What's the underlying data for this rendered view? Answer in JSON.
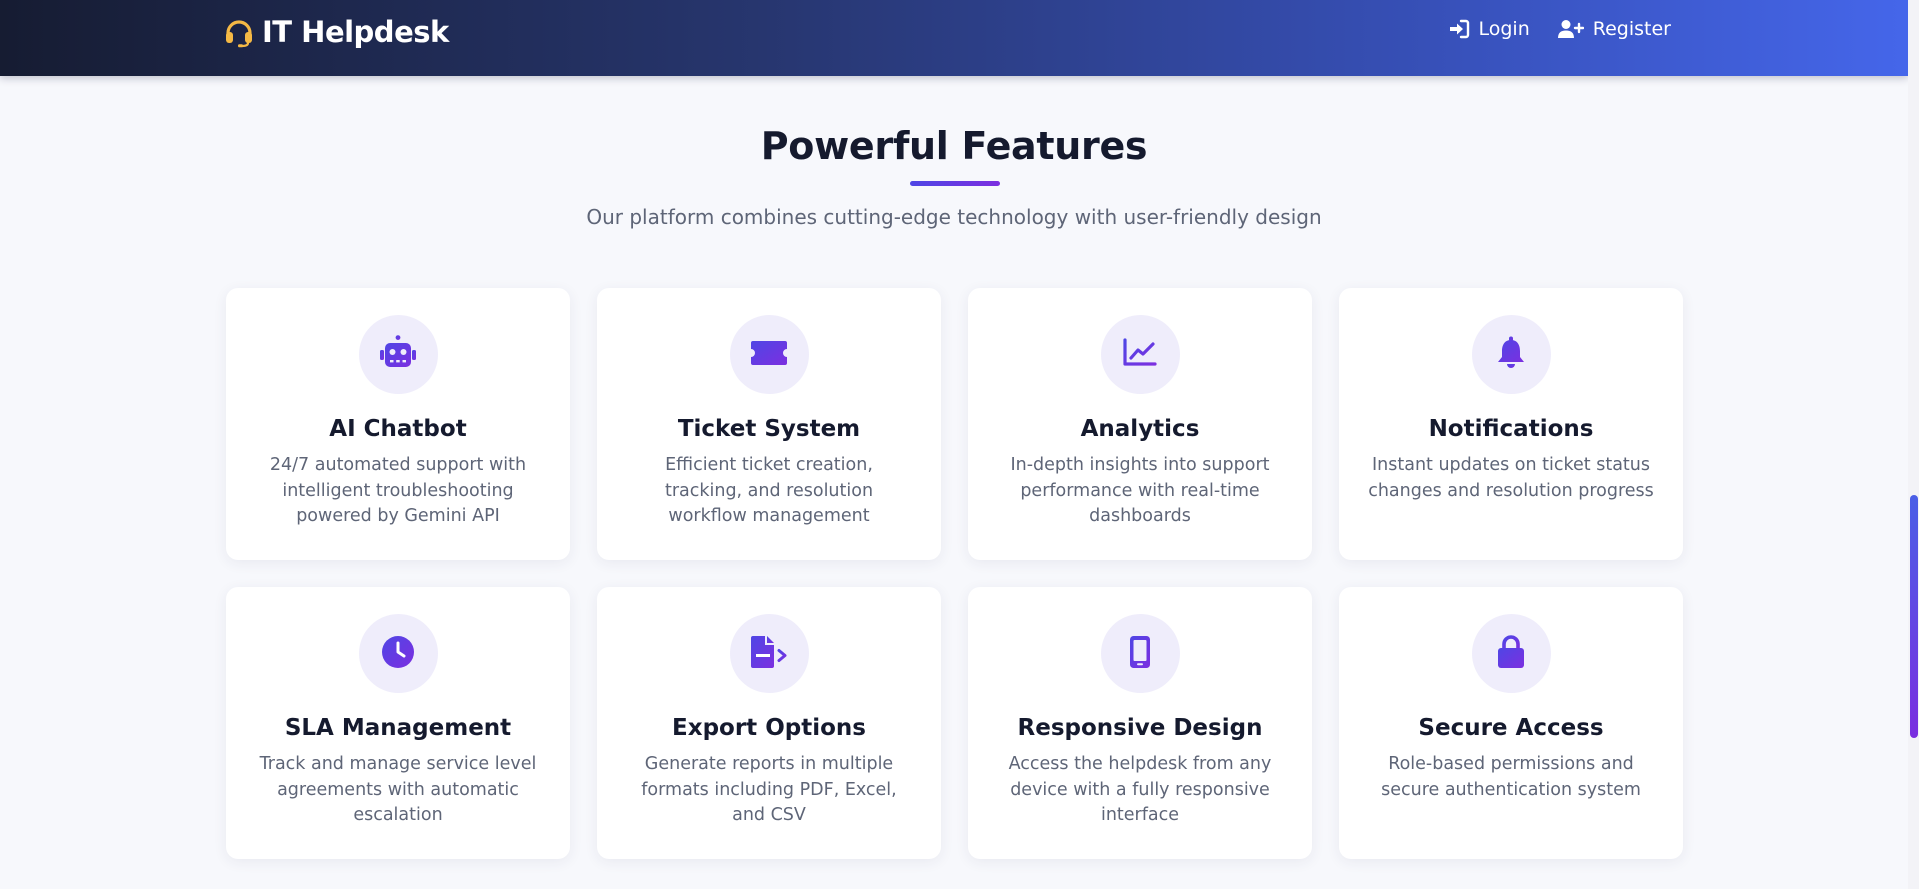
{
  "navbar": {
    "brand": "IT Helpdesk",
    "brand_icon": "headset-icon",
    "login_label": "Login",
    "login_icon": "sign-in-icon",
    "register_label": "Register",
    "register_icon": "user-plus-icon"
  },
  "features": {
    "title": "Powerful Features",
    "subtitle": "Our platform combines cutting-edge technology with user-friendly design",
    "cards": [
      {
        "icon": "robot-icon",
        "title": "AI Chatbot",
        "description": "24/7 automated support with intelligent troubleshooting powered by Gemini API"
      },
      {
        "icon": "ticket-icon",
        "title": "Ticket System",
        "description": "Efficient ticket creation, tracking, and resolution workflow management"
      },
      {
        "icon": "chart-line-icon",
        "title": "Analytics",
        "description": "In-depth insights into support performance with real-time dashboards"
      },
      {
        "icon": "bell-icon",
        "title": "Notifications",
        "description": "Instant updates on ticket status changes and resolution progress"
      },
      {
        "icon": "clock-icon",
        "title": "SLA Management",
        "description": "Track and manage service level agreements with automatic escalation"
      },
      {
        "icon": "file-export-icon",
        "title": "Export Options",
        "description": "Generate reports in multiple formats including PDF, Excel, and CSV"
      },
      {
        "icon": "mobile-icon",
        "title": "Responsive Design",
        "description": "Access the helpdesk from any device with a fully responsive interface"
      },
      {
        "icon": "lock-icon",
        "title": "Secure Access",
        "description": "Role-based permissions and secure authentication system"
      }
    ]
  },
  "colors": {
    "accent_start": "#4f46e5",
    "accent_end": "#7c2fe0",
    "brand_icon": "#f5b945",
    "icon_bg": "#efedfb",
    "nav_start": "#161c32",
    "nav_end": "#4566ea"
  }
}
